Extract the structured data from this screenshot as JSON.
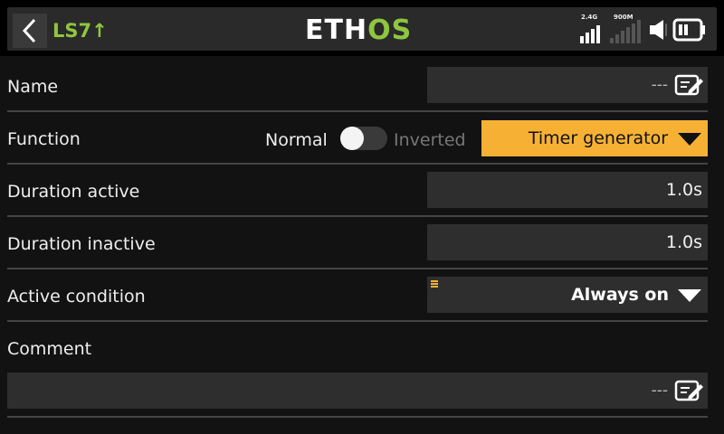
{
  "header": {
    "title": "LS7↑",
    "logo_prefix": "ETH",
    "logo_suffix": "OS",
    "status": {
      "rf1_label": "2.4G",
      "rf2_label": "900M"
    },
    "icons": [
      "back-icon",
      "signal-2-4g-icon",
      "signal-900m-icon",
      "speaker-icon",
      "battery-icon"
    ]
  },
  "rows": {
    "name": {
      "label": "Name",
      "value": "---"
    },
    "function": {
      "label": "Function",
      "toggle_left": "Normal",
      "toggle_right": "Inverted",
      "toggle_state": "Normal",
      "selected": "Timer generator"
    },
    "duration_active": {
      "label": "Duration active",
      "value": "1.0s"
    },
    "duration_inactive": {
      "label": "Duration inactive",
      "value": "1.0s"
    },
    "active_condition": {
      "label": "Active condition",
      "selected": "Always on"
    },
    "comment": {
      "label": "Comment",
      "value": "---"
    }
  },
  "colors": {
    "accent_green": "#8fc63f",
    "accent_orange": "#f6b135",
    "background": "#121212",
    "field": "#2e2e2e"
  }
}
